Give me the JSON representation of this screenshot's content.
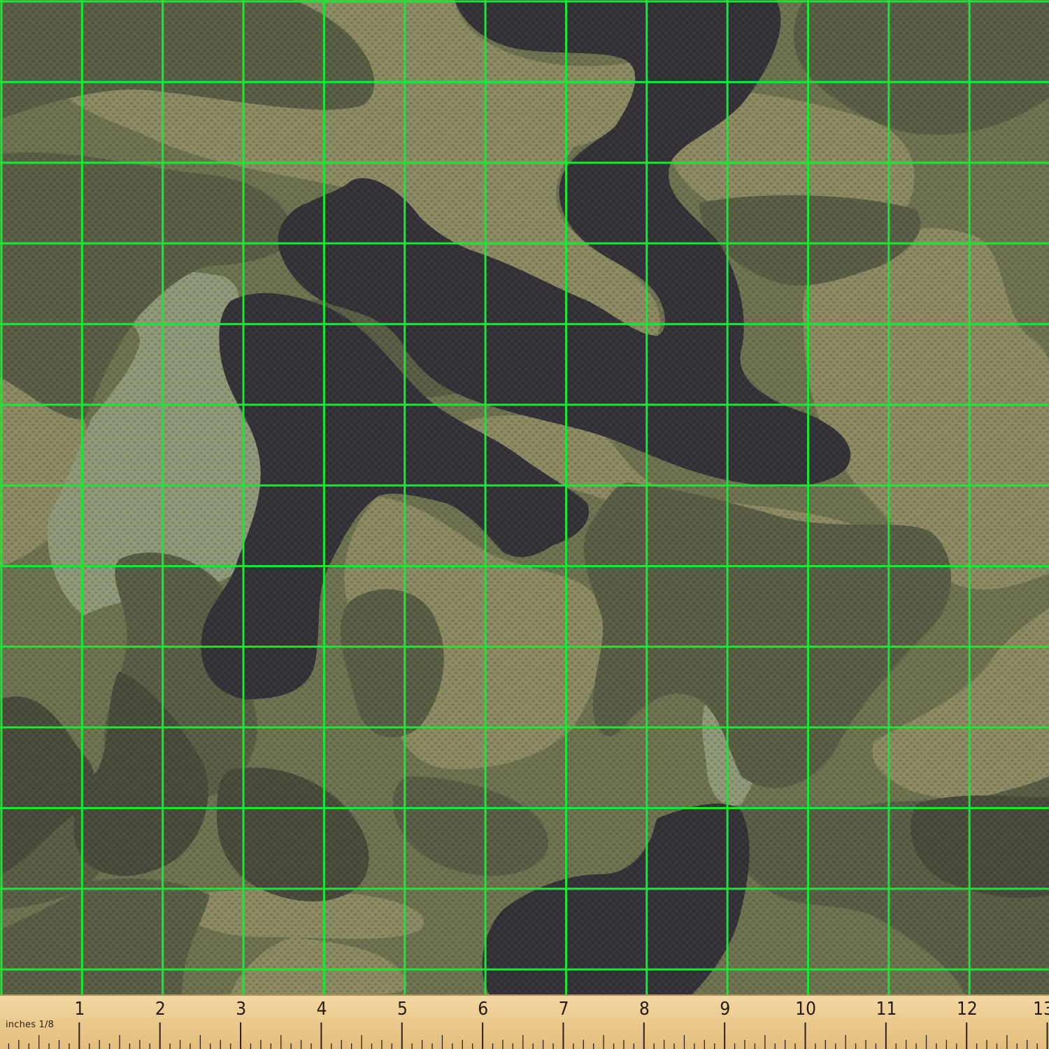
{
  "fabric": {
    "pattern": "woodland camouflage",
    "colors": {
      "base_olive": "#6f7250",
      "light_khaki": "#8c8a62",
      "sage": "#8f9877",
      "mid_green": "#5a5e45",
      "dark_green": "#4a4b3b",
      "charcoal": "#353238",
      "weave_texture": "#2c2a22"
    },
    "grid_line_color": "#18e833"
  },
  "ruler": {
    "unit_label": "inches 1/8",
    "numbers": [
      "1",
      "2",
      "3",
      "4",
      "5",
      "6",
      "7",
      "8",
      "9",
      "10",
      "11",
      "12",
      "13"
    ],
    "colors": {
      "wood": "#eccb8f",
      "ticks": "#2b2117"
    }
  }
}
